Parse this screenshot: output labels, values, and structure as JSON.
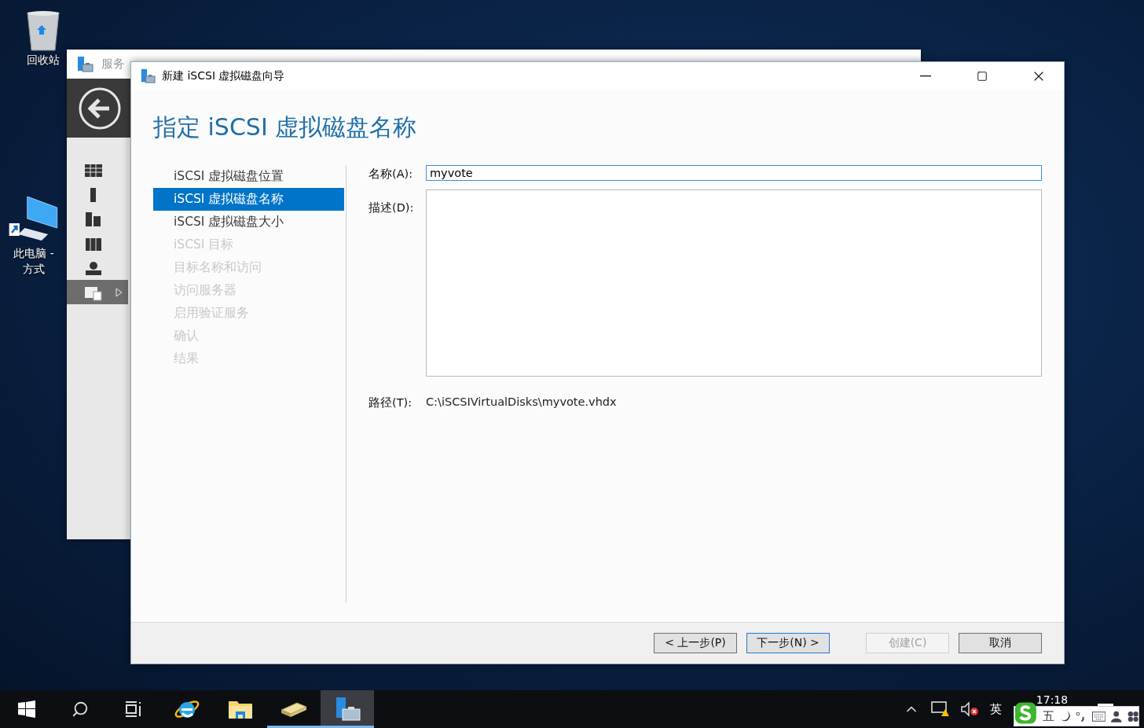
{
  "desktop_icons": [
    {
      "kind": "recycle",
      "label_lines": [
        "回收站"
      ]
    },
    {
      "kind": "computer",
      "label_lines": [
        "此电脑 -",
        "方式"
      ]
    }
  ],
  "background_window": {
    "title": "服务",
    "nav": [
      {
        "kind": "dashboard",
        "selected": false
      },
      {
        "kind": "server",
        "selected": false
      },
      {
        "kind": "servers",
        "selected": false
      },
      {
        "kind": "group",
        "selected": false
      },
      {
        "kind": "network",
        "selected": false
      },
      {
        "kind": "storage",
        "selected": true
      }
    ]
  },
  "wizard": {
    "title": "新建 iSCSI 虚拟磁盘向导",
    "heading": "指定 iSCSI 虚拟磁盘名称",
    "steps": [
      {
        "label": "iSCSI 虚拟磁盘位置",
        "selected": false,
        "disabled": false
      },
      {
        "label": "iSCSI 虚拟磁盘名称",
        "selected": true,
        "disabled": false
      },
      {
        "label": "iSCSI 虚拟磁盘大小",
        "selected": false,
        "disabled": false
      },
      {
        "label": "iSCSI 目标",
        "selected": false,
        "disabled": true
      },
      {
        "label": "目标名称和访问",
        "selected": false,
        "disabled": true
      },
      {
        "label": "访问服务器",
        "selected": false,
        "disabled": true
      },
      {
        "label": "启用验证服务",
        "selected": false,
        "disabled": true
      },
      {
        "label": "确认",
        "selected": false,
        "disabled": true
      },
      {
        "label": "结果",
        "selected": false,
        "disabled": true
      }
    ],
    "fields": [
      {
        "kind": "input",
        "label": "名称(A):",
        "value": "myvote",
        "focused": true
      },
      {
        "kind": "textarea",
        "label": "描述(D):",
        "focused": false
      }
    ],
    "path": {
      "label": "路径(T):",
      "value": "C:\\iSCSIVirtualDisks\\myvote.vhdx"
    },
    "buttons": [
      {
        "label": "< 上一步(P)",
        "disabled": false,
        "default": false
      },
      {
        "label": "下一步(N) >",
        "disabled": false,
        "default": true
      },
      {
        "label": "创建(C)",
        "disabled": true,
        "default": false
      },
      {
        "label": "取消",
        "disabled": false,
        "default": false
      }
    ]
  },
  "taskbar": {
    "apps": [
      {
        "kind": "start",
        "running": false,
        "active": false
      },
      {
        "kind": "search",
        "running": false,
        "active": false
      },
      {
        "kind": "taskview",
        "running": false,
        "active": false
      },
      {
        "kind": "ie",
        "running": false,
        "active": false
      },
      {
        "kind": "explorer",
        "running": false,
        "active": false
      },
      {
        "kind": "disk",
        "running": true,
        "active": false
      },
      {
        "kind": "server-manager",
        "running": true,
        "active": true
      }
    ],
    "tray": {
      "input_mode": "英",
      "time": "17:18"
    },
    "ime_bar": {
      "mode": "五"
    }
  }
}
